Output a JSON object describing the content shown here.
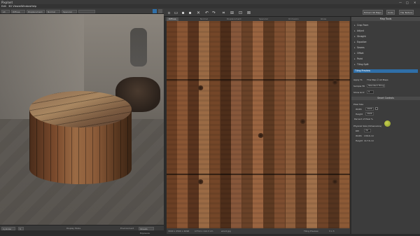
{
  "window": {
    "title": "Pixplant",
    "minimize": "—",
    "maximize": "□",
    "close": "✕"
  },
  "menu": [
    "Edit",
    "3D Viewer",
    "Window",
    "Help"
  ],
  "viewport_toolbar": {
    "labels": [
      "Lit",
      "Diffuse",
      "Displacement",
      "Normal",
      "Specular"
    ]
  },
  "viewport_status": {
    "model_label": "Cylinder",
    "zoom_value": "5",
    "display_mode": "Display Mode",
    "environment_label": "Environment",
    "environment_value": "Streets",
    "exposure_label": "Exposure"
  },
  "main_toolbar": {
    "icons": [
      "new-icon",
      "open-icon",
      "save-icon",
      "save-all-icon",
      "undo-icon",
      "redo-icon",
      "crop-icon",
      "tile-icon",
      "seam-icon",
      "grid-icon"
    ]
  },
  "map_tabs": [
    "Diffuse",
    "Normal",
    "Displacement",
    "Specular",
    "Occlusion",
    "Gloss"
  ],
  "texture_status": {
    "size": "3000 x 2500 x 4096",
    "position": "173.9 x 112.3 cm",
    "file": "wood.jpg",
    "tiling_label": "Tiling Preview",
    "tiling_value": "3 x 3"
  },
  "right_toolbar": {
    "buttons": [
      "Extract 3D Maps",
      "Undo",
      "Tile Texture"
    ]
  },
  "panel": {
    "title": "Map Tools",
    "sections": [
      "Crop From",
      "Adjust",
      "Straight",
      "Equalize",
      "Seams",
      "Offset",
      "Paint",
      "Tiling Split"
    ],
    "tiling_label": "Tiling Preview",
    "apply_to_label": "Apply To",
    "apply_to_value": "This Map ☑ All Maps",
    "sample_fill_label": "Sample Fill",
    "sample_fill_value": "Standard Tiling",
    "show_grid_label": "Show Grid",
    "show_grid_value": "3",
    "smart_controls_title": "Smart Controls",
    "pixel_size": {
      "label": "Pixel Size",
      "width_label": "Width",
      "width_value": "1024",
      "height_label": "Height",
      "height_value": "1024",
      "percent_label": "Percent of Pixel %"
    },
    "physical_size": {
      "label": "Physical Size (Dimensions)",
      "dpi_label": "DPI",
      "dpi_value": "72",
      "width_label": "Width",
      "width_value": "136.6 cm",
      "height_label": "Height",
      "height_value": "117.6 cm"
    }
  },
  "colors": {
    "accent": "#2f6fa8",
    "panel_bg": "#3c3c3c",
    "wood": "#7a4a2c"
  }
}
